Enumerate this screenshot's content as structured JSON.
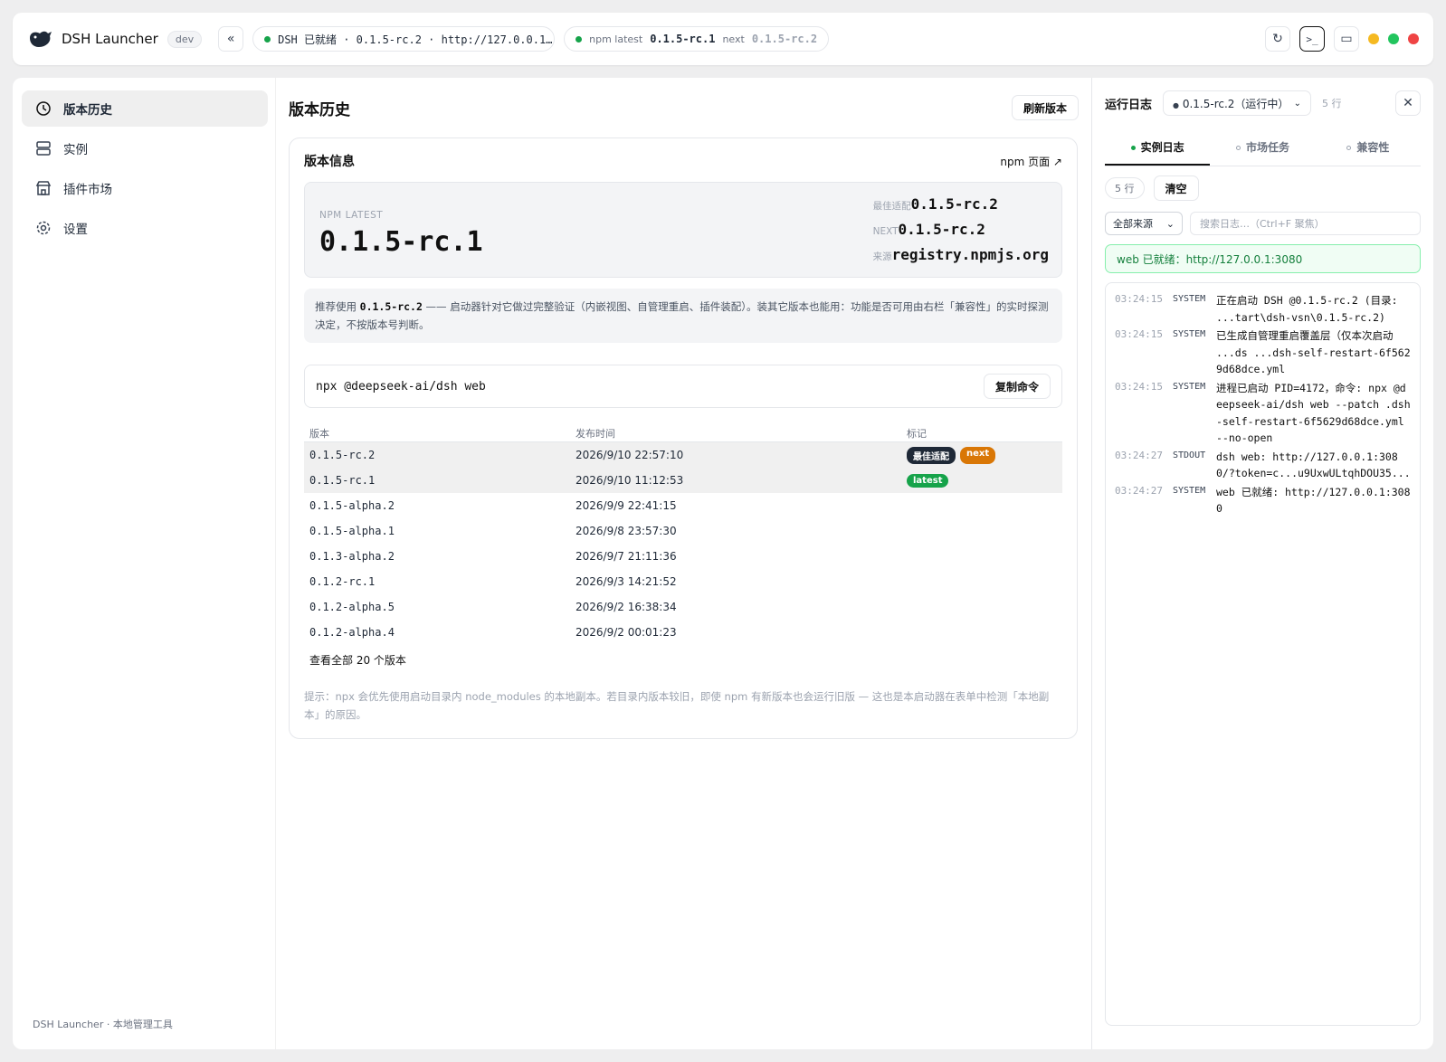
{
  "app": {
    "title": "DSH Launcher",
    "badge": "dev"
  },
  "topbar": {
    "status_pill": "DSH 已就绪 · 0.1.5-rc.2 · http://127.0.0.1…",
    "npm_label": "npm latest",
    "npm_latest": "0.1.5-rc.1",
    "next_label": "next",
    "npm_next": "0.1.5-rc.2"
  },
  "sidebar": {
    "items": [
      {
        "label": "版本历史",
        "icon": "history-icon"
      },
      {
        "label": "实例",
        "icon": "server-icon"
      },
      {
        "label": "插件市场",
        "icon": "store-icon"
      },
      {
        "label": "设置",
        "icon": "gear-icon"
      }
    ],
    "footer": "DSH Launcher · 本地管理工具"
  },
  "main": {
    "title": "版本历史",
    "refresh_label": "刷新版本",
    "card_title": "版本信息",
    "npm_page_link": "npm 页面 ↗",
    "latest_label": "NPM LATEST",
    "latest_version": "0.1.5-rc.1",
    "meta": [
      {
        "k": "最佳适配",
        "v": "0.1.5-rc.2"
      },
      {
        "k": "NEXT",
        "v": "0.1.5-rc.2"
      },
      {
        "k": "来源",
        "v": "registry.npmjs.org"
      }
    ],
    "notice_prefix": "推荐使用 ",
    "notice_version": "0.1.5-rc.2",
    "notice_rest": " —— 启动器针对它做过完整验证（内嵌视图、自管理重启、插件装配）。装其它版本也能用：功能是否可用由右栏「兼容性」的实时探测决定，不按版本号判断。",
    "command": "npx @deepseek-ai/dsh web",
    "copy_label": "复制命令",
    "table": {
      "headers": [
        "版本",
        "发布时间",
        "标记"
      ],
      "rows": [
        {
          "version": "0.1.5-rc.2",
          "time": "2026/9/10 22:57:10",
          "tags": [
            {
              "text": "最佳适配",
              "color": "#1f2937"
            },
            {
              "text": "next",
              "color": "#d97706"
            }
          ]
        },
        {
          "version": "0.1.5-rc.1",
          "time": "2026/9/10 11:12:53",
          "tags": [
            {
              "text": "latest",
              "color": "#16a34a"
            }
          ]
        },
        {
          "version": "0.1.5-alpha.2",
          "time": "2026/9/9 22:41:15",
          "tags": []
        },
        {
          "version": "0.1.5-alpha.1",
          "time": "2026/9/8 23:57:30",
          "tags": []
        },
        {
          "version": "0.1.3-alpha.2",
          "time": "2026/9/7 21:11:36",
          "tags": []
        },
        {
          "version": "0.1.2-rc.1",
          "time": "2026/9/3 14:21:52",
          "tags": []
        },
        {
          "version": "0.1.2-alpha.5",
          "time": "2026/9/2 16:38:34",
          "tags": []
        },
        {
          "version": "0.1.2-alpha.4",
          "time": "2026/9/2 00:01:23",
          "tags": []
        }
      ]
    },
    "view_all": "查看全部 20 个版本",
    "hint": "提示：npx 会优先使用启动目录内 node_modules 的本地副本。若目录内版本较旧，即使 npm 有新版本也会运行旧版 — 这也是本启动器在表单中检测「本地副本」的原因。"
  },
  "rpanel": {
    "title": "运行日志",
    "instance_select": "0.1.5-rc.2（运行中）",
    "line_count": "5 行",
    "tabs": [
      "实例日志",
      "市场任务",
      "兼容性"
    ],
    "lines_pill": "5 行",
    "clear_label": "清空",
    "source_select": "全部来源",
    "search_placeholder": "搜索日志…（Ctrl+F 聚焦）",
    "ready_text": "web 已就绪：http://127.0.0.1:3080",
    "logs": [
      {
        "time": "03:24:15",
        "src": "SYSTEM",
        "msg": "正在启动 DSH @0.1.5-rc.2 (目录: ...tart\\dsh-vsn\\0.1.5-rc.2)"
      },
      {
        "time": "03:24:15",
        "src": "SYSTEM",
        "msg": "已生成自管理重启覆盖层（仅本次启动 ...ds ...dsh-self-restart-6f5629d68dce.yml"
      },
      {
        "time": "03:24:15",
        "src": "SYSTEM",
        "msg": "进程已启动 PID=4172，命令: npx @deepseek-ai/dsh web --patch .dsh-self-restart-6f5629d68dce.yml --no-open"
      },
      {
        "time": "03:24:27",
        "src": "STDOUT",
        "msg": "dsh web: http://127.0.0.1:3080/?token=c...u9UxwULtqhDOU35..."
      },
      {
        "time": "03:24:27",
        "src": "SYSTEM",
        "msg": "web 已就绪: http://127.0.0.1:3080"
      }
    ]
  },
  "colors": {
    "ready_green": "#16a34a",
    "close_red": "#ef4444",
    "min_yellow": "#f5b921",
    "max_green": "#22c55e"
  }
}
